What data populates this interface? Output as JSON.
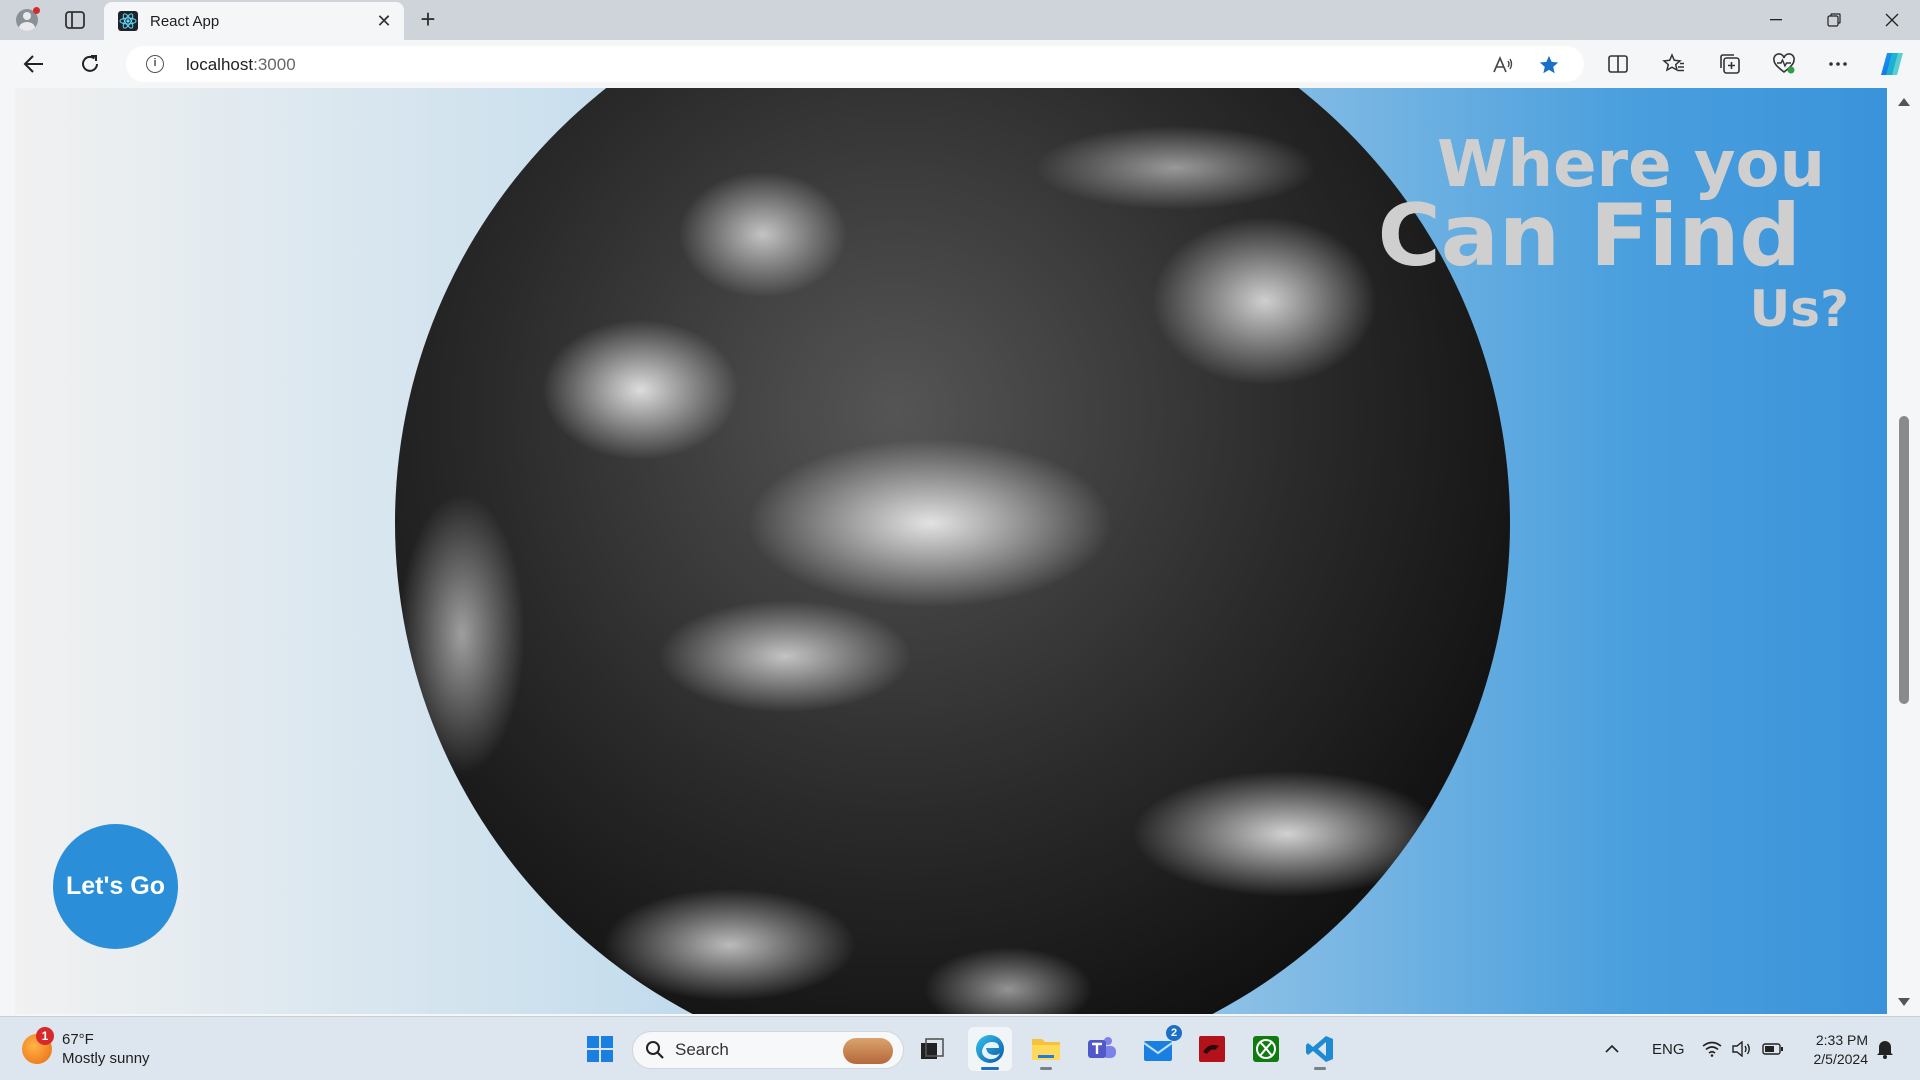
{
  "browser": {
    "tab": {
      "title": "React App",
      "favicon": "react-logo-icon",
      "close_label": "✕"
    },
    "new_tab_label": "+",
    "window_controls": {
      "minimize": "—",
      "restore": "❐",
      "close": "✕"
    },
    "address": {
      "host": "localhost",
      "port": ":3000"
    },
    "accent": "#1a6fc9"
  },
  "page": {
    "headline": {
      "line1": "Where you",
      "line2": "Can Find",
      "line3": "Us?"
    },
    "cta_label": "Let's Go",
    "colors": {
      "gradient_start": "#f1f1f1",
      "gradient_end": "#3a93da",
      "button": "#2a8fd8",
      "headline": "#cfcfcf"
    }
  },
  "taskbar": {
    "weather": {
      "temperature": "67°F",
      "condition": "Mostly sunny",
      "badge": "1"
    },
    "search_placeholder": "Search",
    "mail_badge": "2",
    "language": "ENG",
    "time": "2:33 PM",
    "date": "2/5/2024",
    "apps": [
      "windows-start-icon",
      "task-view-icon",
      "edge-browser-icon",
      "file-explorer-icon",
      "teams-icon",
      "mail-icon",
      "red-app-icon",
      "xbox-icon",
      "vscode-icon"
    ]
  }
}
